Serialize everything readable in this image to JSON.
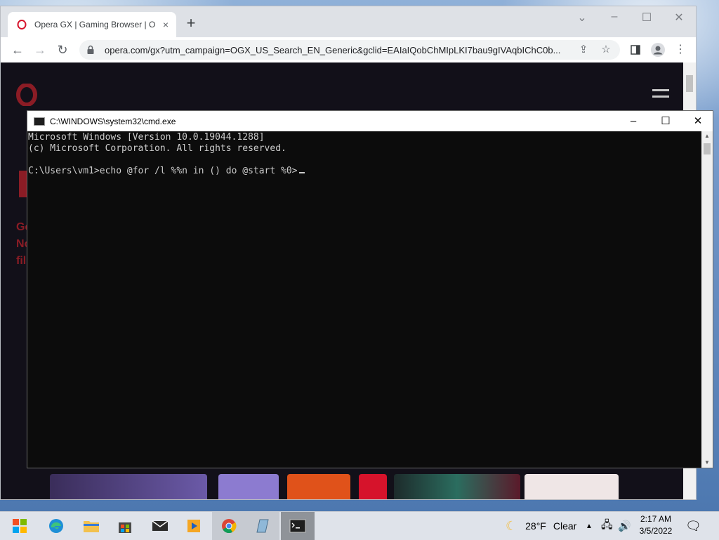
{
  "browser": {
    "tab_title": "Opera GX | Gaming Browser | Opera",
    "tab_close": "×",
    "new_tab": "+",
    "url": "opera.com/gx?utm_campaign=OGX_US_Search_EN_Generic&gclid=EAIaIQobChMIpLKI7bau9gIVAqbIChC0b...",
    "window_controls": [
      "⌄",
      "–",
      "☐",
      "✕"
    ]
  },
  "page": {
    "lines": [
      "Ge",
      "No",
      "fil"
    ]
  },
  "cmd": {
    "title": "C:\\WINDOWS\\system32\\cmd.exe",
    "lines": [
      "Microsoft Windows [Version 10.0.19044.1288]",
      "(c) Microsoft Corporation. All rights reserved.",
      "",
      "C:\\Users\\vm1>echo @for /l %%n in () do @start %0>"
    ]
  },
  "taskbar": {
    "weather_temp": "28°F",
    "weather_cond": "Clear",
    "time": "2:17 AM",
    "date": "3/5/2022"
  },
  "colors": {
    "opera_red": "#d6132b",
    "cmd_bg": "#0c0c0c",
    "cmd_text": "#cccccc",
    "taskbar_bg": "#dfe3ea"
  }
}
